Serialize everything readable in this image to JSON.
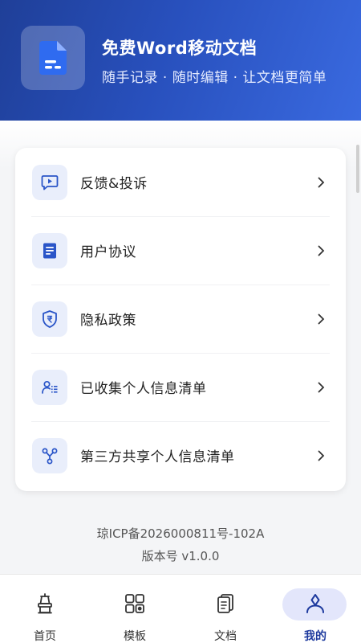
{
  "app": {
    "title": "免费Word移动文档",
    "subtitle": "随手记录 · 随时编辑 · 让文档更简单"
  },
  "menu": {
    "items": [
      {
        "label": "反馈&投诉",
        "icon": "feedback-icon"
      },
      {
        "label": "用户协议",
        "icon": "document-icon"
      },
      {
        "label": "隐私政策",
        "icon": "shield-icon"
      },
      {
        "label": "已收集个人信息清单",
        "icon": "user-list-icon"
      },
      {
        "label": "第三方共享个人信息清单",
        "icon": "share-icon"
      }
    ]
  },
  "footer": {
    "icp": "琼ICP备2026000811号-102A",
    "version": "版本号 v1.0.0"
  },
  "tabbar": {
    "tabs": [
      {
        "label": "首页",
        "icon": "home-icon"
      },
      {
        "label": "模板",
        "icon": "template-icon"
      },
      {
        "label": "文档",
        "icon": "document-icon"
      },
      {
        "label": "我的",
        "icon": "profile-icon",
        "active": true
      }
    ]
  },
  "colors": {
    "header_start": "#1f3f98",
    "header_end": "#3a6ae0",
    "accent": "#2a55c8",
    "icon_bg": "#e9eefb",
    "active_pill": "#e3e6fb"
  }
}
